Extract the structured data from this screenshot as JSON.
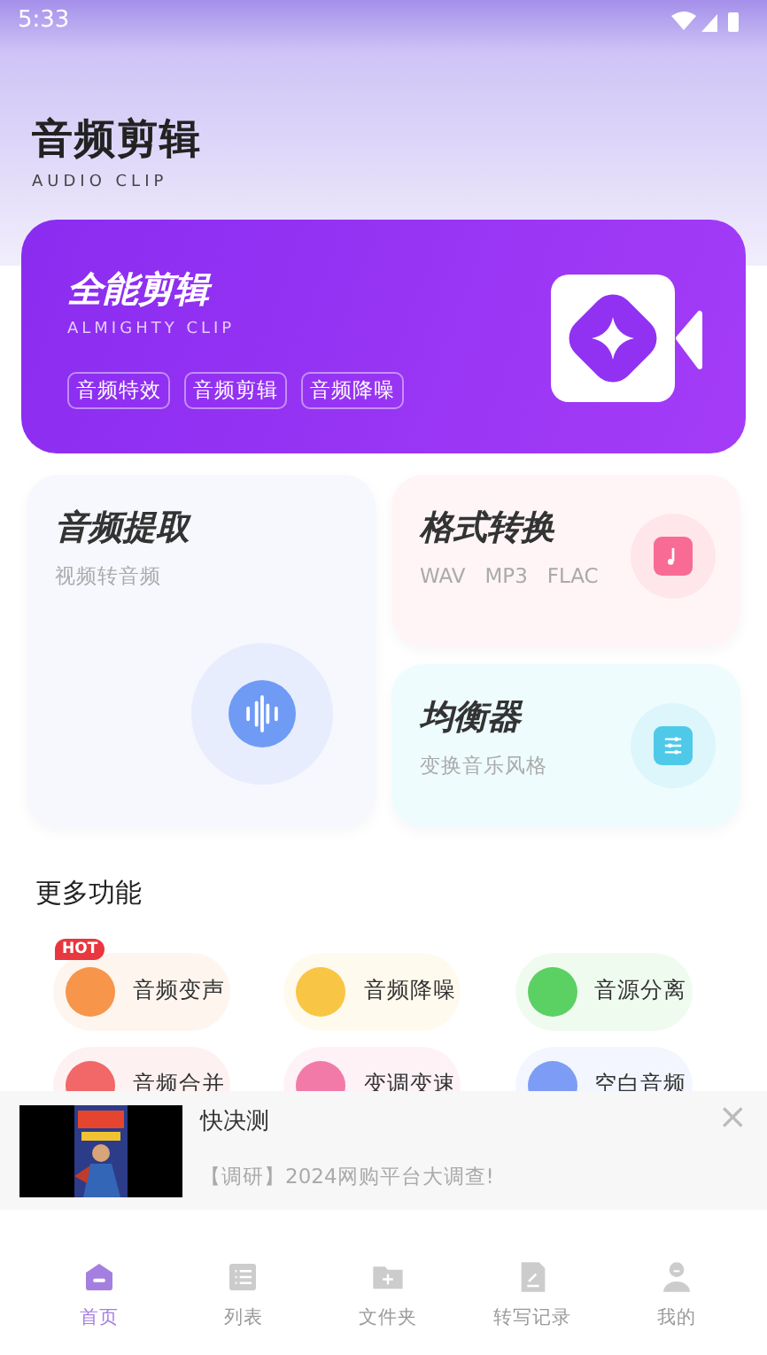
{
  "status_bar": {
    "time": "5:33"
  },
  "header": {
    "title": "音频剪辑",
    "subtitle": "AUDIO CLIP"
  },
  "banner": {
    "title": "全能剪辑",
    "subtitle": "ALMIGHTY CLIP",
    "tags": [
      "音频特效",
      "音频剪辑",
      "音频降噪"
    ]
  },
  "cards": [
    {
      "kind": "large",
      "title": "音频提取",
      "subtitle": "视频转音频",
      "color": "#6f9bf5"
    },
    {
      "kind": "small",
      "title": "格式转换",
      "subtitle": "WAV   MP3   FLAC",
      "color": "#f76b95"
    },
    {
      "kind": "small",
      "title": "均衡器",
      "subtitle": "变换音乐风格",
      "color": "#4fc9e8"
    }
  ],
  "more": {
    "title": "更多功能",
    "items": [
      {
        "label": "音频变声",
        "color": "#f7954a",
        "hot": "HOT"
      },
      {
        "label": "音频降噪",
        "color": "#f9c544"
      },
      {
        "label": "音源分离",
        "color": "#5bd063"
      },
      {
        "label": "音频合并",
        "color": "#f26767"
      },
      {
        "label": "变调变速",
        "color": "#f27aa8"
      },
      {
        "label": "空白音频",
        "color": "#7d9cf5"
      }
    ]
  },
  "ad": {
    "title": "快决测",
    "text": "【调研】2024网购平台大调查!",
    "close": "×"
  },
  "nav": [
    {
      "label": "首页",
      "selected": true
    },
    {
      "label": "列表",
      "selected": false
    },
    {
      "label": "文件夹",
      "selected": false
    },
    {
      "label": "转写记录",
      "selected": false
    },
    {
      "label": "我的",
      "selected": false
    }
  ]
}
